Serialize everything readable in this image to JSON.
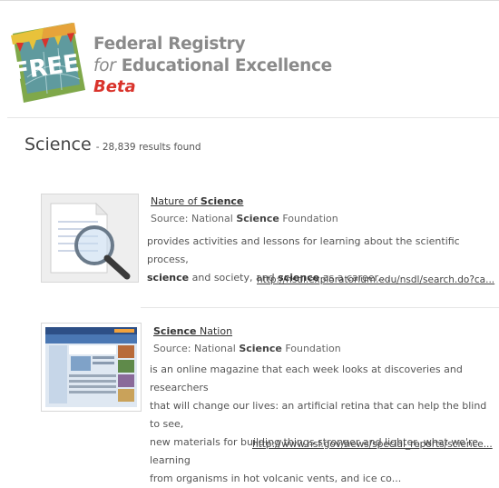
{
  "logo": {
    "badge_text": "FREE"
  },
  "brand": {
    "line1": "Federal Registry",
    "line2_prefix": "for",
    "line2_rest": "Educational Excellence",
    "beta": "Beta"
  },
  "search": {
    "term": "Science",
    "count_text": "- 28,839 results found"
  },
  "results": [
    {
      "title_pre": "Nature of ",
      "title_bold": "Science",
      "title_post": "",
      "source_pre": "Source: National ",
      "source_bold": "Science",
      "source_post": " Foundation",
      "desc_1": "provides activities and lessons for learning about the scientific process,",
      "desc_2_bold_a": "science",
      "desc_2_mid": " and society, and ",
      "desc_2_bold_b": "science",
      "desc_2_end": " as a career....",
      "url": "http://nsdl.exploratorium.edu/nsdl/search.do?ca..."
    },
    {
      "title_pre": "",
      "title_bold": "Science",
      "title_post": " Nation",
      "source_pre": "Source: National ",
      "source_bold": "Science",
      "source_post": " Foundation",
      "desc_lines": [
        "is an online magazine that each week looks at discoveries and researchers",
        "that will change our lives: an artificial retina that can help the blind to see,",
        "new materials for building things stronger and lighter, what we're learning",
        "from organisms in hot volcanic vents, and ice co..."
      ],
      "url": "http://www.nsf.gov/news/special_reports/science..."
    }
  ]
}
